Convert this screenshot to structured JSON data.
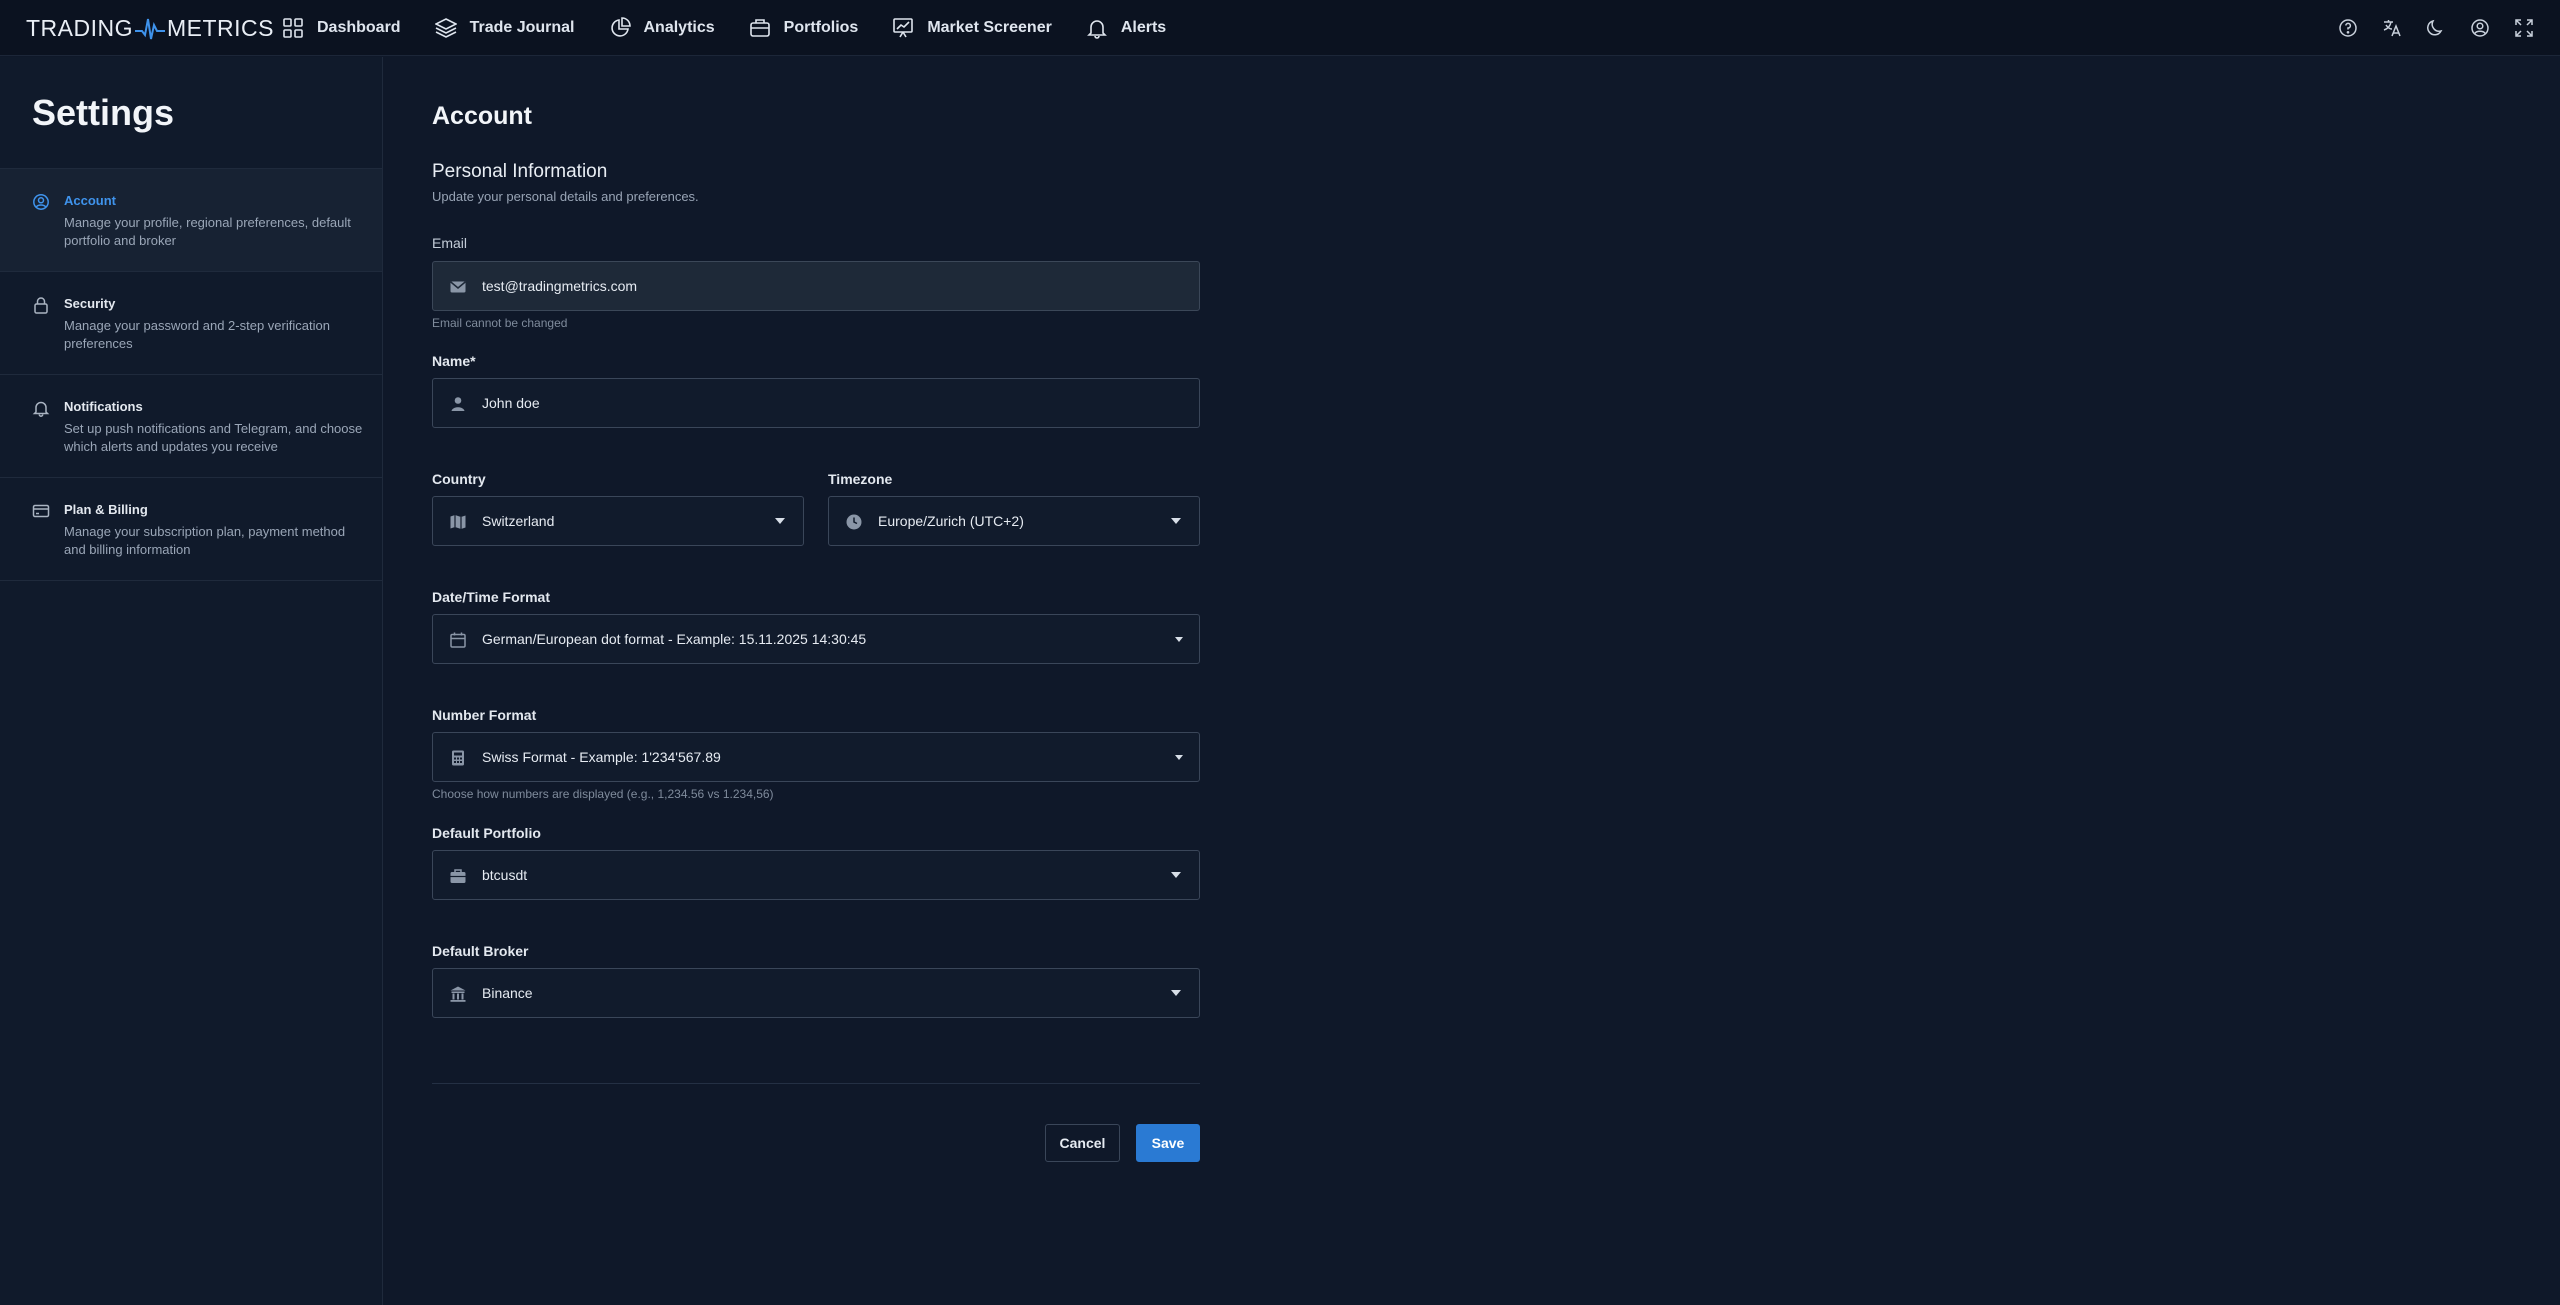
{
  "brand": {
    "left": "TRADING",
    "right": "METRICS"
  },
  "nav": [
    {
      "label": "Dashboard",
      "icon": "grid-icon"
    },
    {
      "label": "Trade Journal",
      "icon": "layers-icon"
    },
    {
      "label": "Analytics",
      "icon": "pie-chart-icon"
    },
    {
      "label": "Portfolios",
      "icon": "briefcase-icon"
    },
    {
      "label": "Market Screener",
      "icon": "presentation-chart-icon"
    },
    {
      "label": "Alerts",
      "icon": "bell-icon"
    }
  ],
  "top_icons": [
    "help-icon",
    "translate-icon",
    "moon-icon",
    "user-circle-icon",
    "fullscreen-icon"
  ],
  "sidebar": {
    "title": "Settings",
    "items": [
      {
        "title": "Account",
        "desc": "Manage your profile, regional preferences, default portfolio and broker",
        "icon": "user-circle-icon",
        "active": true
      },
      {
        "title": "Security",
        "desc": "Manage your password and 2-step verification preferences",
        "icon": "lock-icon",
        "active": false
      },
      {
        "title": "Notifications",
        "desc": "Set up push notifications and Telegram, and choose which alerts and updates you receive",
        "icon": "bell-icon",
        "active": false
      },
      {
        "title": "Plan & Billing",
        "desc": "Manage your subscription plan, payment method and billing information",
        "icon": "credit-card-icon",
        "active": false
      }
    ]
  },
  "main": {
    "title": "Account",
    "section_title": "Personal Information",
    "section_sub": "Update your personal details and preferences.",
    "email": {
      "label": "Email",
      "value": "test@tradingmetrics.com",
      "helper": "Email cannot be changed"
    },
    "name": {
      "label": "Name*",
      "value": "John doe"
    },
    "country": {
      "label": "Country",
      "value": "Switzerland"
    },
    "timezone": {
      "label": "Timezone",
      "value": "Europe/Zurich (UTC+2)"
    },
    "datetime": {
      "label": "Date/Time Format",
      "value": "German/European dot format - Example: 15.11.2025 14:30:45"
    },
    "number": {
      "label": "Number Format",
      "value": "Swiss Format - Example: 1'234'567.89",
      "helper": "Choose how numbers are displayed (e.g., 1,234.56 vs 1.234,56)"
    },
    "portfolio": {
      "label": "Default Portfolio",
      "value": "btcusdt"
    },
    "broker": {
      "label": "Default Broker",
      "value": "Binance"
    },
    "cancel_label": "Cancel",
    "save_label": "Save"
  },
  "colors": {
    "accent": "#2a7ad3",
    "active_link": "#3f93ec",
    "background": "#0f1829",
    "topbar": "#0b1220"
  }
}
